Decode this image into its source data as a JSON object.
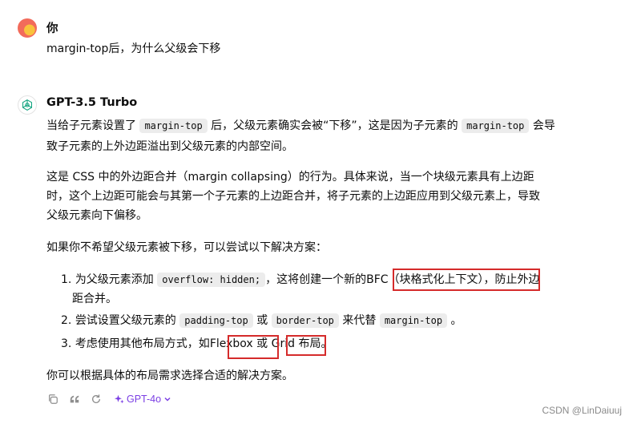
{
  "user": {
    "name": "你",
    "message": "margin-top后，为什么父级会下移"
  },
  "assistant": {
    "name": "GPT-3.5 Turbo",
    "p1_l1_a": "当给子元素设置了",
    "p1_l1_code1": "margin-top",
    "p1_l1_b": "后，父级元素确实会被“下移”，这是因为子元素的",
    "p1_l1_code2": "margin-top",
    "p1_l1_c": "会导",
    "p1_l2": "致子元素的上外边距溢出到父级元素的内部空间。",
    "p2_l1": "这是 CSS 中的外边距合并（margin collapsing）的行为。具体来说，当一个块级元素具有上边距",
    "p2_l2": "时，这个上边距可能会与其第一个子元素的上边距合并，将子元素的上边距应用到父级元素上，导致",
    "p2_l3": "父级元素向下偏移。",
    "p3": "如果你不希望父级元素被下移，可以尝试以下解决方案：",
    "li1_num": "1.",
    "li1_a": "为父级元素添加",
    "li1_code": "overflow: hidden;",
    "li1_b": "，这将创建一个新的",
    "li1_c": "BFC（块格式化上下文）",
    "li1_d": "，防止外边",
    "li1_l2": "距合并。",
    "li2_num": "2.",
    "li2_a": "尝试设置父级元素的",
    "li2_code1": "padding-top",
    "li2_b": "或",
    "li2_code2": "border-top",
    "li2_c": "来代替",
    "li2_code3": "margin-top",
    "li2_d": "。",
    "li3_num": "3.",
    "li3_a": "考虑使用其他布局方式，如",
    "li3_b": "Flexbox",
    "li3_c": "或",
    "li3_d": "Grid",
    "li3_e": "布局。",
    "p4": "你可以根据具体的布局需求选择合适的解决方案。"
  },
  "toolbar": {
    "icons": [
      "copy-icon",
      "quote-icon",
      "regenerate-icon",
      "sparkle-icon",
      "chevron-down-icon"
    ],
    "model_label": "GPT-4o"
  },
  "watermark": "CSDN @LinDaiuuj",
  "colors": {
    "highlight": "#d52b2b",
    "model_accent": "#7b3fe4",
    "code_bg": "#ececec"
  }
}
